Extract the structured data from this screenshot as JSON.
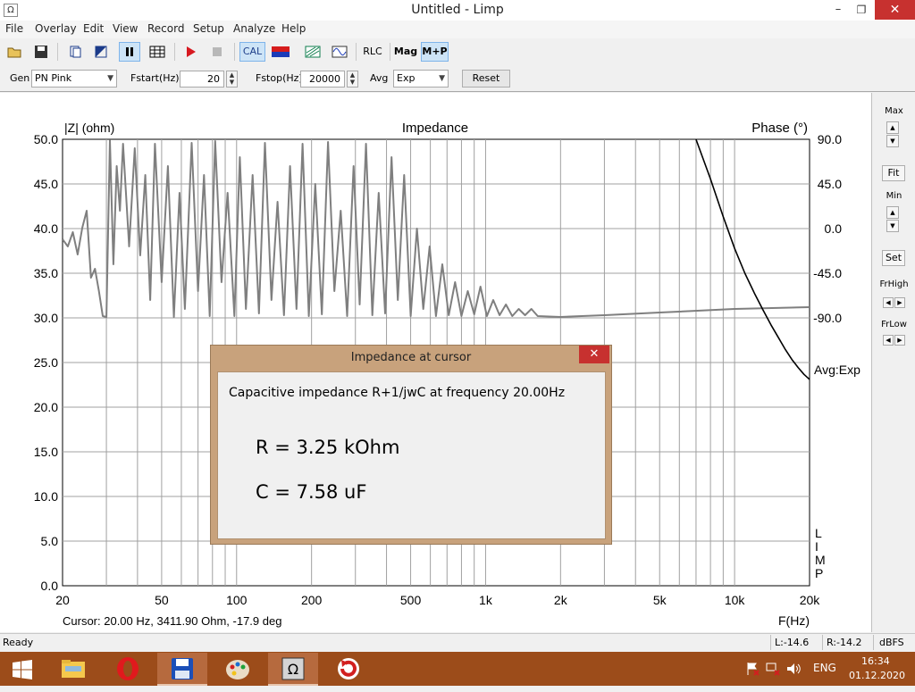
{
  "window": {
    "title": "Untitled - Limp",
    "app_icon_glyph": "Ω",
    "minimize_glyph": "–",
    "maximize_glyph": "❐",
    "close_glyph": "✕"
  },
  "menu": [
    "File",
    "Overlay",
    "Edit",
    "View",
    "Record",
    "Setup",
    "Analyze",
    "Help"
  ],
  "toolbar": {
    "icons": [
      "open-folder-icon",
      "save-disk-icon",
      "copy-icon",
      "overlay-icon",
      "pause-icon",
      "grid-icon",
      "play-icon",
      "stop-icon"
    ],
    "cal_label": "CAL",
    "rlc_label": "RLC",
    "mag_label": "Mag",
    "mp_label": "M+P",
    "mag_color": "#0e7d6c",
    "cal_pressed": true,
    "mp_pressed": true
  },
  "controls": {
    "gen_label": "Gen",
    "gen_value": "PN Pink",
    "fstart_label": "Fstart(Hz)",
    "fstart_value": "20",
    "fstop_label": "Fstop(Hz)",
    "fstop_value": "20000",
    "avg_label": "Avg",
    "avg_value": "Exp",
    "reset_label": "Reset"
  },
  "plot": {
    "left_axis_label": "|Z| (ohm)",
    "title": "Impedance",
    "right_axis_label": "Phase (°)",
    "avg_label": "Avg:Exp",
    "watermark": "LIMP",
    "cursor_readout": "Cursor: 20.00 Hz, 3411.90 Ohm, -17.9 deg",
    "x_axis_label": "F(Hz)"
  },
  "chart_data": {
    "type": "line",
    "title": "Impedance",
    "xlabel": "F(Hz)",
    "ylabel": "|Z| (ohm)",
    "y2label": "Phase (°)",
    "x_scale": "log",
    "xlim": [
      20,
      20000
    ],
    "ylim": [
      0,
      50
    ],
    "y2lim": [
      -90,
      90
    ],
    "grid": true,
    "x_ticks": [
      20,
      50,
      100,
      200,
      500,
      1000,
      2000,
      5000,
      10000,
      20000
    ],
    "x_tick_labels": [
      "20",
      "50",
      "100",
      "200",
      "500",
      "1k",
      "2k",
      "5k",
      "10k",
      "20k"
    ],
    "y_tick_labels": [
      "50.0",
      "45.0",
      "40.0",
      "35.0",
      "30.0",
      "25.0",
      "20.0",
      "15.0",
      "10.0",
      "5.0",
      "0.0"
    ],
    "y2_tick_labels": [
      "90.0",
      "45.0",
      "0.0",
      "-45.0",
      "-90.0"
    ],
    "series": [
      {
        "axis": "left",
        "color": "#7f7f7f",
        "points": [
          [
            20,
            38.8
          ],
          [
            21,
            38
          ],
          [
            22,
            39.6
          ],
          [
            23,
            37.1
          ],
          [
            24,
            40.1
          ],
          [
            25,
            42
          ],
          [
            26,
            34.5
          ],
          [
            27,
            35.5
          ],
          [
            28,
            33
          ],
          [
            29,
            30.2
          ],
          [
            30,
            30.1
          ],
          [
            31,
            49.9
          ],
          [
            32,
            36
          ],
          [
            33,
            47
          ],
          [
            34,
            42
          ],
          [
            35,
            49.5
          ],
          [
            37,
            38
          ],
          [
            39,
            49
          ],
          [
            41,
            37
          ],
          [
            43,
            46
          ],
          [
            45,
            32
          ],
          [
            47,
            49.5
          ],
          [
            50,
            34
          ],
          [
            53,
            47
          ],
          [
            56,
            30.1
          ],
          [
            59,
            44
          ],
          [
            62,
            31
          ],
          [
            66,
            49.6
          ],
          [
            70,
            33
          ],
          [
            74,
            46
          ],
          [
            78,
            30.2
          ],
          [
            82,
            49.8
          ],
          [
            87,
            34
          ],
          [
            92,
            44
          ],
          [
            98,
            30.2
          ],
          [
            103,
            48
          ],
          [
            109,
            31
          ],
          [
            116,
            46
          ],
          [
            123,
            30.5
          ],
          [
            130,
            49.6
          ],
          [
            138,
            32
          ],
          [
            146,
            43
          ],
          [
            155,
            30.3
          ],
          [
            164,
            47
          ],
          [
            174,
            31
          ],
          [
            184,
            49.5
          ],
          [
            195,
            30.2
          ],
          [
            207,
            45
          ],
          [
            220,
            30.4
          ],
          [
            233,
            49.7
          ],
          [
            247,
            33
          ],
          [
            262,
            42
          ],
          [
            278,
            30.2
          ],
          [
            295,
            47
          ],
          [
            312,
            31.5
          ],
          [
            331,
            49.5
          ],
          [
            351,
            30.3
          ],
          [
            372,
            44
          ],
          [
            395,
            30.5
          ],
          [
            419,
            48
          ],
          [
            444,
            32
          ],
          [
            471,
            46
          ],
          [
            500,
            30.2
          ],
          [
            530,
            40
          ],
          [
            562,
            31
          ],
          [
            596,
            38
          ],
          [
            632,
            30.2
          ],
          [
            670,
            36
          ],
          [
            711,
            30.3
          ],
          [
            754,
            34
          ],
          [
            800,
            30.2
          ],
          [
            848,
            33
          ],
          [
            900,
            30.4
          ],
          [
            954,
            33.5
          ],
          [
            1012,
            30.2
          ],
          [
            1073,
            32
          ],
          [
            1138,
            30.3
          ],
          [
            1207,
            31.5
          ],
          [
            1280,
            30.2
          ],
          [
            1358,
            31
          ],
          [
            1440,
            30.3
          ],
          [
            1527,
            31
          ],
          [
            1620,
            30.2
          ],
          [
            2000,
            30.1
          ],
          [
            3000,
            30.3
          ],
          [
            5000,
            30.6
          ],
          [
            10000,
            31.0
          ],
          [
            20000,
            31.2
          ]
        ]
      },
      {
        "axis": "right",
        "color": "#000000",
        "points": [
          [
            7000,
            90
          ],
          [
            8000,
            50
          ],
          [
            9000,
            12
          ],
          [
            10000,
            -20
          ],
          [
            11000,
            -45
          ],
          [
            12000,
            -65
          ],
          [
            13000,
            -82
          ],
          [
            14000,
            -97
          ],
          [
            15000,
            -110
          ],
          [
            16000,
            -122
          ],
          [
            17000,
            -132
          ],
          [
            18000,
            -140
          ],
          [
            19000,
            -147
          ],
          [
            20000,
            -152
          ]
        ]
      }
    ]
  },
  "right_panel": {
    "max_label": "Max",
    "fit_label": "Fit",
    "min_label": "Min",
    "set_label": "Set",
    "frhigh_label": "FrHigh",
    "frlow_label": "FrLow"
  },
  "dialog": {
    "title": "Impedance at cursor",
    "description": "Capacitive impedance R+1/jwC at frequency 20.00Hz",
    "r_text": "R = 3.25 kOhm",
    "c_text": "C = 7.58 uF",
    "close_glyph": "✕"
  },
  "statusbar": {
    "ready": "Ready",
    "left_level": "L:-14.6",
    "right_level": "R:-14.2",
    "unit": "dBFS"
  },
  "taskbar": {
    "apps": [
      "start-windows-icon",
      "file-explorer-icon",
      "opera-icon",
      "floppy-disk-icon",
      "paint-icon",
      "limp-omega-icon",
      "refresh-app-icon"
    ],
    "active_app": "limp-omega-icon",
    "language": "ENG",
    "time": "16:34",
    "date": "01.12.2020"
  }
}
